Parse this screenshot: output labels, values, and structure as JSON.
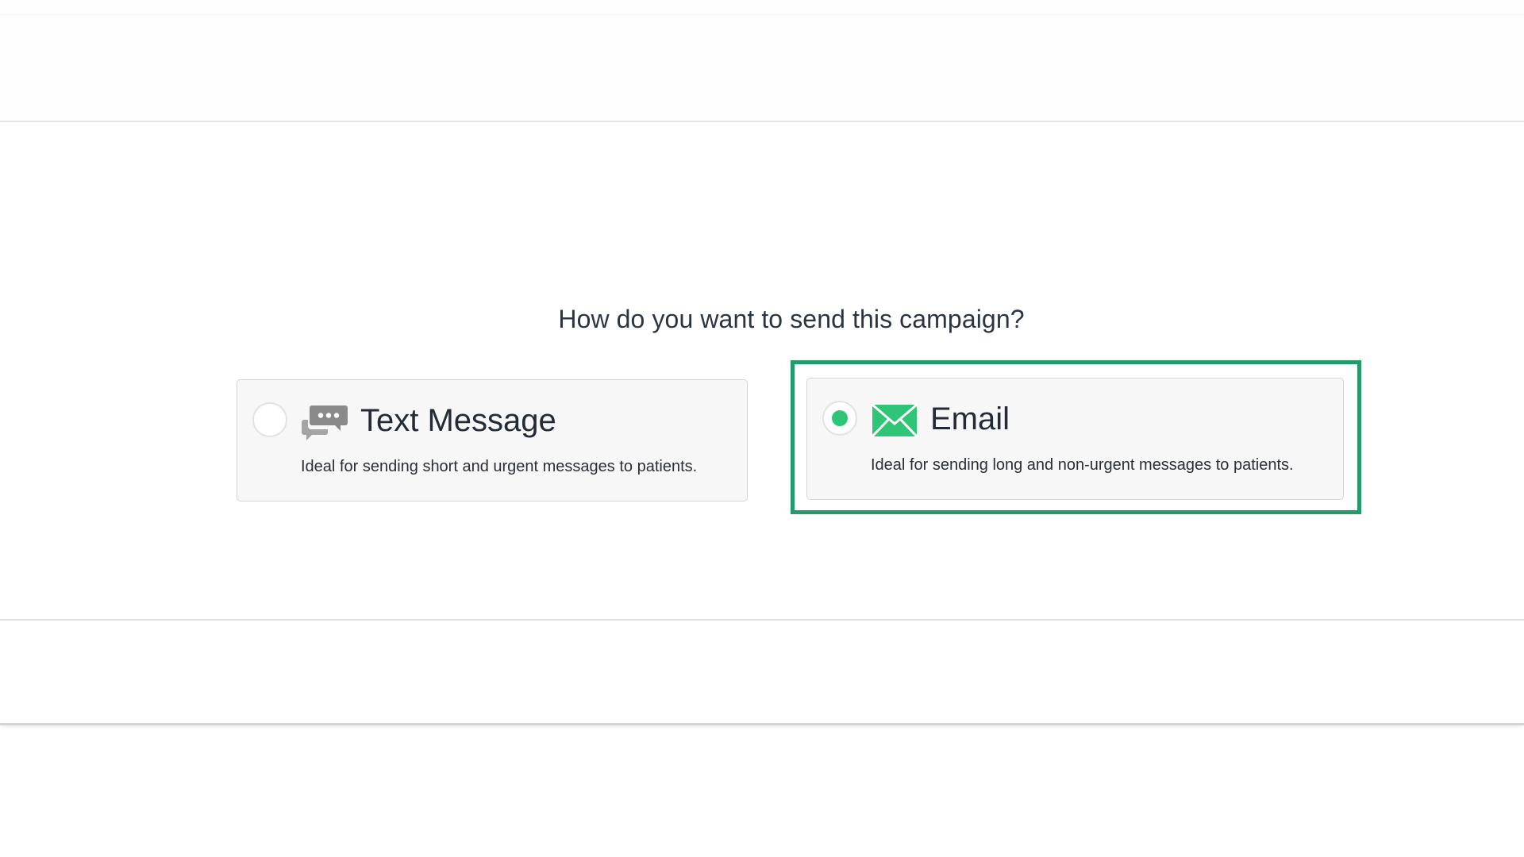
{
  "prompt": {
    "question": "How do you want to send this campaign?"
  },
  "options": [
    {
      "id": "text-message",
      "title": "Text Message",
      "description": "Ideal for sending short and urgent messages to patients.",
      "selected": false,
      "icon": "chat-bubbles-icon"
    },
    {
      "id": "email",
      "title": "Email",
      "description": "Ideal for sending long and non-urgent messages to patients.",
      "selected": true,
      "icon": "envelope-icon"
    }
  ],
  "colors": {
    "accent_green": "#2fc576",
    "highlight_border": "#229a6a",
    "icon_gray": "#8a8a8a"
  }
}
